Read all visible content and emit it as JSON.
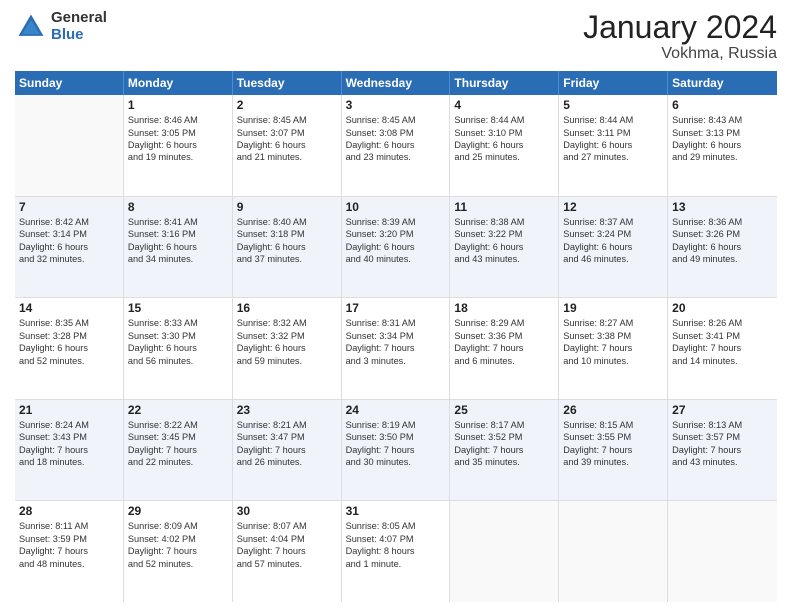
{
  "logo": {
    "general": "General",
    "blue": "Blue"
  },
  "title": "January 2024",
  "location": "Vokhma, Russia",
  "days_of_week": [
    "Sunday",
    "Monday",
    "Tuesday",
    "Wednesday",
    "Thursday",
    "Friday",
    "Saturday"
  ],
  "weeks": [
    [
      {
        "day": "",
        "lines": []
      },
      {
        "day": "1",
        "lines": [
          "Sunrise: 8:46 AM",
          "Sunset: 3:05 PM",
          "Daylight: 6 hours",
          "and 19 minutes."
        ]
      },
      {
        "day": "2",
        "lines": [
          "Sunrise: 8:45 AM",
          "Sunset: 3:07 PM",
          "Daylight: 6 hours",
          "and 21 minutes."
        ]
      },
      {
        "day": "3",
        "lines": [
          "Sunrise: 8:45 AM",
          "Sunset: 3:08 PM",
          "Daylight: 6 hours",
          "and 23 minutes."
        ]
      },
      {
        "day": "4",
        "lines": [
          "Sunrise: 8:44 AM",
          "Sunset: 3:10 PM",
          "Daylight: 6 hours",
          "and 25 minutes."
        ]
      },
      {
        "day": "5",
        "lines": [
          "Sunrise: 8:44 AM",
          "Sunset: 3:11 PM",
          "Daylight: 6 hours",
          "and 27 minutes."
        ]
      },
      {
        "day": "6",
        "lines": [
          "Sunrise: 8:43 AM",
          "Sunset: 3:13 PM",
          "Daylight: 6 hours",
          "and 29 minutes."
        ]
      }
    ],
    [
      {
        "day": "7",
        "lines": [
          "Sunrise: 8:42 AM",
          "Sunset: 3:14 PM",
          "Daylight: 6 hours",
          "and 32 minutes."
        ]
      },
      {
        "day": "8",
        "lines": [
          "Sunrise: 8:41 AM",
          "Sunset: 3:16 PM",
          "Daylight: 6 hours",
          "and 34 minutes."
        ]
      },
      {
        "day": "9",
        "lines": [
          "Sunrise: 8:40 AM",
          "Sunset: 3:18 PM",
          "Daylight: 6 hours",
          "and 37 minutes."
        ]
      },
      {
        "day": "10",
        "lines": [
          "Sunrise: 8:39 AM",
          "Sunset: 3:20 PM",
          "Daylight: 6 hours",
          "and 40 minutes."
        ]
      },
      {
        "day": "11",
        "lines": [
          "Sunrise: 8:38 AM",
          "Sunset: 3:22 PM",
          "Daylight: 6 hours",
          "and 43 minutes."
        ]
      },
      {
        "day": "12",
        "lines": [
          "Sunrise: 8:37 AM",
          "Sunset: 3:24 PM",
          "Daylight: 6 hours",
          "and 46 minutes."
        ]
      },
      {
        "day": "13",
        "lines": [
          "Sunrise: 8:36 AM",
          "Sunset: 3:26 PM",
          "Daylight: 6 hours",
          "and 49 minutes."
        ]
      }
    ],
    [
      {
        "day": "14",
        "lines": [
          "Sunrise: 8:35 AM",
          "Sunset: 3:28 PM",
          "Daylight: 6 hours",
          "and 52 minutes."
        ]
      },
      {
        "day": "15",
        "lines": [
          "Sunrise: 8:33 AM",
          "Sunset: 3:30 PM",
          "Daylight: 6 hours",
          "and 56 minutes."
        ]
      },
      {
        "day": "16",
        "lines": [
          "Sunrise: 8:32 AM",
          "Sunset: 3:32 PM",
          "Daylight: 6 hours",
          "and 59 minutes."
        ]
      },
      {
        "day": "17",
        "lines": [
          "Sunrise: 8:31 AM",
          "Sunset: 3:34 PM",
          "Daylight: 7 hours",
          "and 3 minutes."
        ]
      },
      {
        "day": "18",
        "lines": [
          "Sunrise: 8:29 AM",
          "Sunset: 3:36 PM",
          "Daylight: 7 hours",
          "and 6 minutes."
        ]
      },
      {
        "day": "19",
        "lines": [
          "Sunrise: 8:27 AM",
          "Sunset: 3:38 PM",
          "Daylight: 7 hours",
          "and 10 minutes."
        ]
      },
      {
        "day": "20",
        "lines": [
          "Sunrise: 8:26 AM",
          "Sunset: 3:41 PM",
          "Daylight: 7 hours",
          "and 14 minutes."
        ]
      }
    ],
    [
      {
        "day": "21",
        "lines": [
          "Sunrise: 8:24 AM",
          "Sunset: 3:43 PM",
          "Daylight: 7 hours",
          "and 18 minutes."
        ]
      },
      {
        "day": "22",
        "lines": [
          "Sunrise: 8:22 AM",
          "Sunset: 3:45 PM",
          "Daylight: 7 hours",
          "and 22 minutes."
        ]
      },
      {
        "day": "23",
        "lines": [
          "Sunrise: 8:21 AM",
          "Sunset: 3:47 PM",
          "Daylight: 7 hours",
          "and 26 minutes."
        ]
      },
      {
        "day": "24",
        "lines": [
          "Sunrise: 8:19 AM",
          "Sunset: 3:50 PM",
          "Daylight: 7 hours",
          "and 30 minutes."
        ]
      },
      {
        "day": "25",
        "lines": [
          "Sunrise: 8:17 AM",
          "Sunset: 3:52 PM",
          "Daylight: 7 hours",
          "and 35 minutes."
        ]
      },
      {
        "day": "26",
        "lines": [
          "Sunrise: 8:15 AM",
          "Sunset: 3:55 PM",
          "Daylight: 7 hours",
          "and 39 minutes."
        ]
      },
      {
        "day": "27",
        "lines": [
          "Sunrise: 8:13 AM",
          "Sunset: 3:57 PM",
          "Daylight: 7 hours",
          "and 43 minutes."
        ]
      }
    ],
    [
      {
        "day": "28",
        "lines": [
          "Sunrise: 8:11 AM",
          "Sunset: 3:59 PM",
          "Daylight: 7 hours",
          "and 48 minutes."
        ]
      },
      {
        "day": "29",
        "lines": [
          "Sunrise: 8:09 AM",
          "Sunset: 4:02 PM",
          "Daylight: 7 hours",
          "and 52 minutes."
        ]
      },
      {
        "day": "30",
        "lines": [
          "Sunrise: 8:07 AM",
          "Sunset: 4:04 PM",
          "Daylight: 7 hours",
          "and 57 minutes."
        ]
      },
      {
        "day": "31",
        "lines": [
          "Sunrise: 8:05 AM",
          "Sunset: 4:07 PM",
          "Daylight: 8 hours",
          "and 1 minute."
        ]
      },
      {
        "day": "",
        "lines": []
      },
      {
        "day": "",
        "lines": []
      },
      {
        "day": "",
        "lines": []
      }
    ]
  ]
}
